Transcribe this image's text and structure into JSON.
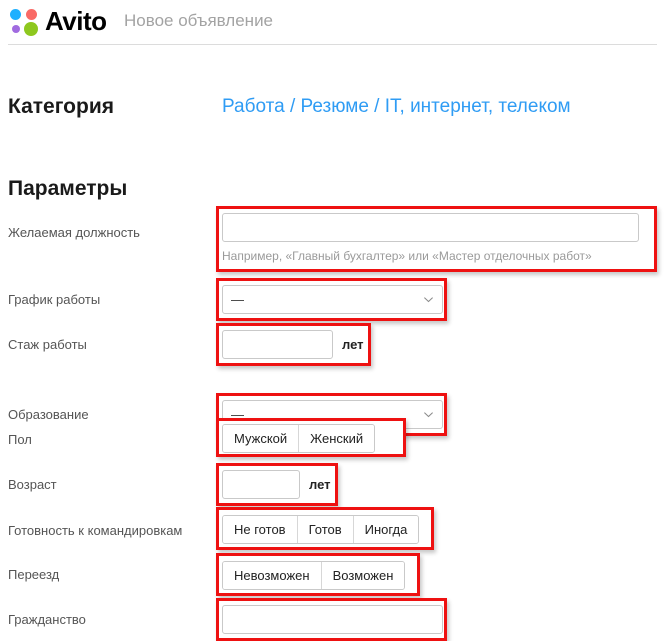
{
  "header": {
    "logo_text": "Avito",
    "logo_icon": "avito-dots-logo",
    "subtitle": "Новое объявление",
    "logo_colors": {
      "blue": "#1eb0ff",
      "red": "#f96a66",
      "purple": "#a16be0",
      "green": "#8ec81f"
    }
  },
  "category": {
    "title": "Категория",
    "value": "Работа / Резюме / IT, интернет, телеком",
    "link_color": "#2f9cf4"
  },
  "params": {
    "title": "Параметры",
    "highlight_color": "#ee1111",
    "rows": [
      {
        "label": "Желаемая должность",
        "type": "text",
        "value": "",
        "placeholder": "",
        "hint": "Например, «Главный бухгалтер» или «Мастер отделочных работ»"
      },
      {
        "label": "График работы",
        "type": "select",
        "value": "—",
        "icon": "chevron-down-icon"
      },
      {
        "label": "Стаж работы",
        "type": "text-unit",
        "value": "",
        "unit": "лет"
      },
      {
        "label": "Образование",
        "type": "select",
        "value": "—",
        "icon": "chevron-down-icon"
      },
      {
        "label": "Пол",
        "type": "segmented",
        "options": [
          "Мужской",
          "Женский"
        ]
      },
      {
        "label": "Возраст",
        "type": "text-unit",
        "value": "",
        "unit": "лет"
      },
      {
        "label": "Готовность к командировкам",
        "type": "segmented",
        "options": [
          "Не готов",
          "Готов",
          "Иногда"
        ]
      },
      {
        "label": "Переезд",
        "type": "segmented",
        "options": [
          "Невозможен",
          "Возможен"
        ]
      },
      {
        "label": "Гражданство",
        "type": "text",
        "value": "",
        "placeholder": ""
      }
    ]
  }
}
